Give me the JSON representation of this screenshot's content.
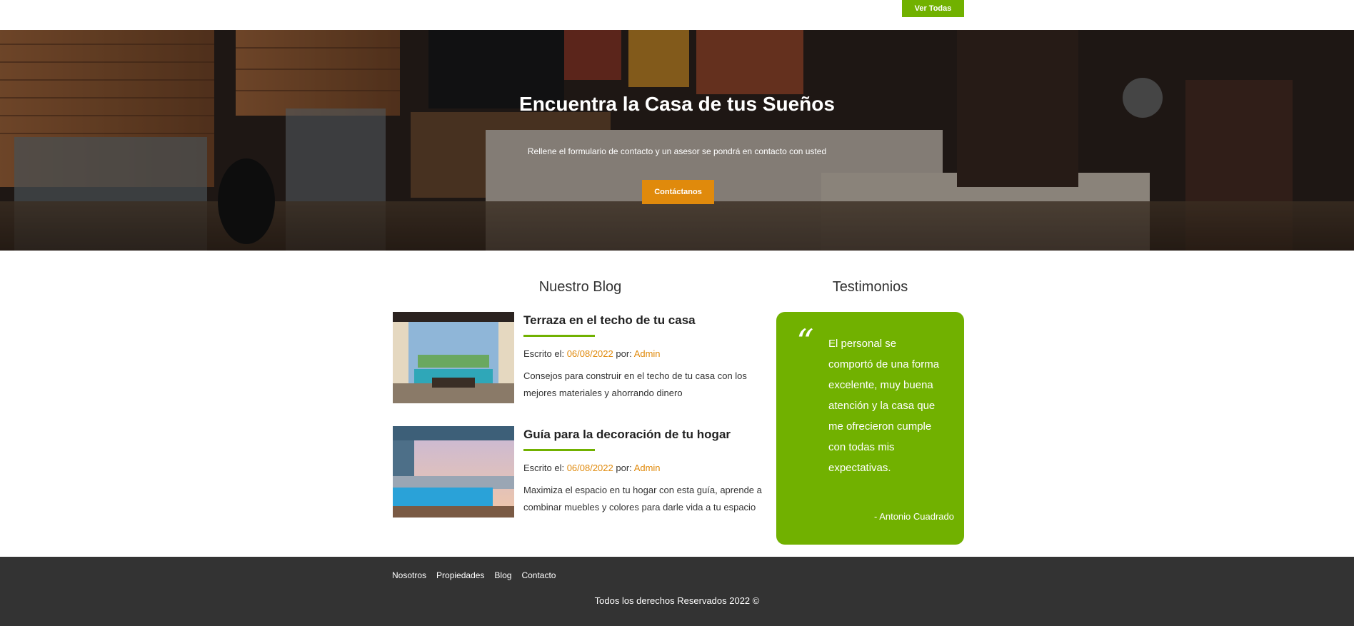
{
  "top": {
    "ver_todas": "Ver Todas"
  },
  "hero": {
    "title": "Encuentra la Casa de tus Sueños",
    "text": "Rellene el formulario de contacto y un asesor se pondrá en contacto con usted",
    "button": "Contáctanos"
  },
  "blog": {
    "title": "Nuestro Blog",
    "posts": [
      {
        "title": "Terraza en el techo de tu casa",
        "meta_label": "Escrito el: ",
        "date": "06/08/2022",
        "by_label": " por: ",
        "author": "Admin",
        "description": "Consejos para construir en el techo de tu casa con los mejores materiales y ahorrando dinero"
      },
      {
        "title": "Guía para la decoración de tu hogar",
        "meta_label": "Escrito el: ",
        "date": "06/08/2022",
        "by_label": " por: ",
        "author": "Admin",
        "description": "Maximiza el espacio en tu hogar con esta guía, aprende a combinar muebles y colores para darle vida a tu espacio"
      }
    ]
  },
  "testimonials": {
    "title": "Testimonios",
    "quote_mark": "“",
    "quote": "El personal se comportó de una forma excelente, muy buena atención y la casa que me ofrecieron cumple con todas mis expectativas.",
    "author": "- Antonio Cuadrado"
  },
  "footer": {
    "nav": [
      "Nosotros",
      "Propiedades",
      "Blog",
      "Contacto"
    ],
    "copyright": "Todos los derechos Reservados 2022 ©"
  },
  "colors": {
    "primary_green": "#71b100",
    "accent_orange": "#e08a0c",
    "footer_bg": "#333333"
  }
}
